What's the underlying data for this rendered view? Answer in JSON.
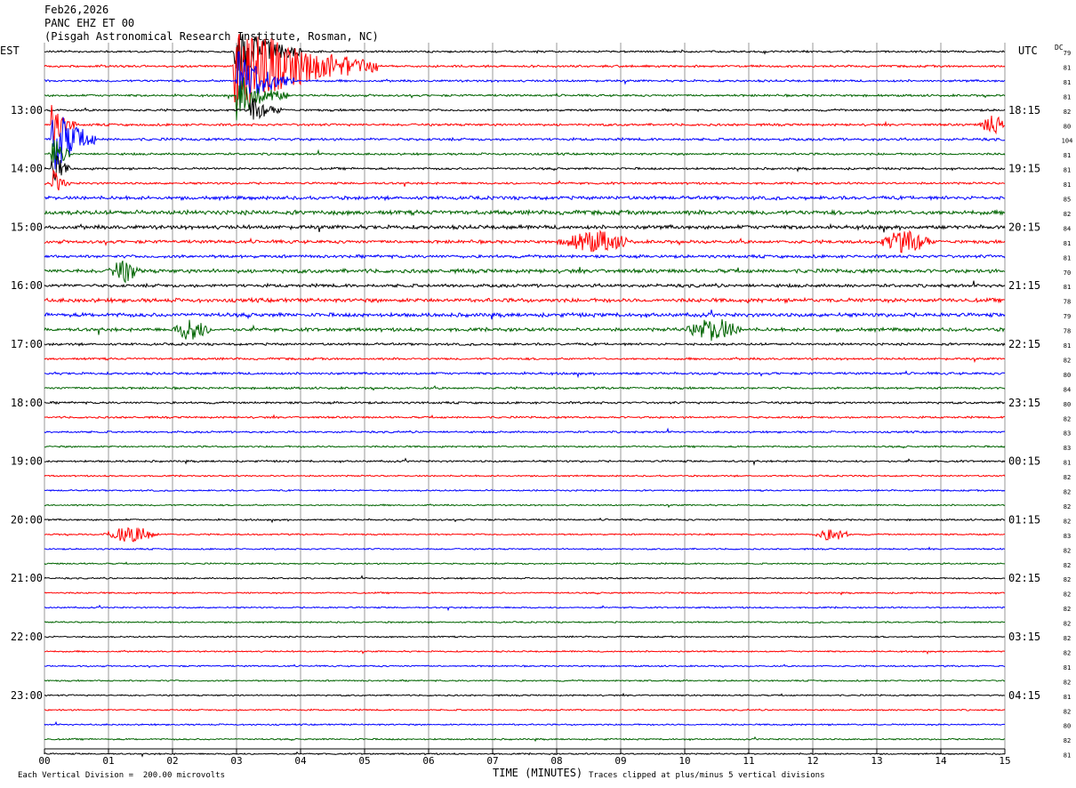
{
  "header": {
    "date": "Feb26,2026",
    "station": "PANC EHZ ET 00",
    "location": "(Pisgah Astronomical Research Institute, Rosman, NC)"
  },
  "left_timezone": "EST",
  "right_timezone": "UTC",
  "dc_label": "DC",
  "footer": {
    "scale": "Each Vertical Division =  200.00 microvolts",
    "clip_note": "Traces clipped at plus/minus 5 vertical divisions"
  },
  "colors": {
    "trace_cycle": [
      "#000000",
      "#ff0000",
      "#0000ff",
      "#006400"
    ],
    "grid": "#808080"
  },
  "chart_data": {
    "type": "line",
    "title": "PANC EHZ ET 00",
    "xlabel": "TIME (MINUTES)",
    "xlim": [
      0,
      15
    ],
    "x_ticks": [
      "00",
      "01",
      "02",
      "03",
      "04",
      "05",
      "06",
      "07",
      "08",
      "09",
      "10",
      "11",
      "12",
      "13",
      "14",
      "15"
    ],
    "left_hour_labels": [
      "13:00",
      "14:00",
      "15:00",
      "16:00",
      "17:00",
      "18:00",
      "19:00",
      "20:00",
      "21:00",
      "22:00",
      "23:00"
    ],
    "right_hour_labels": [
      "18:15",
      "19:15",
      "20:15",
      "21:15",
      "22:15",
      "23:15",
      "00:15",
      "01:15",
      "02:15",
      "03:15",
      "04:15"
    ],
    "first_hour_label_row": 4,
    "rows_per_hour": 4,
    "dc_values": [
      "79",
      "81",
      "81",
      "81",
      "82",
      "80",
      "104",
      "81",
      "81",
      "81",
      "85",
      "82",
      "84",
      "81",
      "81",
      "70",
      "81",
      "78",
      "79",
      "78",
      "81",
      "82",
      "80",
      "84",
      "80",
      "82",
      "83",
      "83",
      "81",
      "82",
      "82",
      "82",
      "82",
      "83",
      "82",
      "82",
      "82",
      "82",
      "82",
      "82",
      "82",
      "82",
      "81",
      "82",
      "81",
      "82",
      "80",
      "82",
      "81"
    ],
    "series_rows": 49,
    "row_noise": [
      0.9,
      1.0,
      1.0,
      1.0,
      1.0,
      1.1,
      1.2,
      1.0,
      1.0,
      1.0,
      1.6,
      2.0,
      1.8,
      1.5,
      1.4,
      1.8,
      1.5,
      1.8,
      1.8,
      1.6,
      1.1,
      1.0,
      1.1,
      1.0,
      1.0,
      0.9,
      0.9,
      0.8,
      0.9,
      0.7,
      0.7,
      0.7,
      0.8,
      0.7,
      0.7,
      0.7,
      0.7,
      0.7,
      0.7,
      0.7,
      0.7,
      0.7,
      0.7,
      0.7,
      0.7,
      0.7,
      0.7,
      0.7,
      0.7
    ],
    "events": [
      {
        "row": 1,
        "start_min": 2.95,
        "end_min": 5.2,
        "peak": 6,
        "clipped": true
      },
      {
        "row": 0,
        "start_min": 2.95,
        "end_min": 4.0,
        "peak": 4,
        "clipped": true
      },
      {
        "row": 2,
        "start_min": 3.0,
        "end_min": 3.9,
        "peak": 4,
        "clipped": true
      },
      {
        "row": 3,
        "start_min": 3.0,
        "end_min": 3.8,
        "peak": 3,
        "clipped": true
      },
      {
        "row": 4,
        "start_min": 3.2,
        "end_min": 3.7,
        "peak": 2,
        "clipped": true
      },
      {
        "row": 6,
        "start_min": 0.1,
        "end_min": 0.8,
        "peak": 5,
        "clipped": true
      },
      {
        "row": 5,
        "start_min": 0.1,
        "end_min": 0.5,
        "peak": 3,
        "clipped": true
      },
      {
        "row": 7,
        "start_min": 0.1,
        "end_min": 0.4,
        "peak": 3,
        "clipped": true
      },
      {
        "row": 8,
        "start_min": 0.1,
        "end_min": 0.4,
        "peak": 3,
        "clipped": true
      },
      {
        "row": 9,
        "start_min": 0.1,
        "end_min": 0.4,
        "peak": 2,
        "clipped": true
      },
      {
        "row": 5,
        "start_min": 14.6,
        "end_min": 15.0,
        "peak": 1.2,
        "clipped": false
      },
      {
        "row": 33,
        "start_min": 0.9,
        "end_min": 1.8,
        "peak": 0.9,
        "clipped": false
      },
      {
        "row": 33,
        "start_min": 12.0,
        "end_min": 12.6,
        "peak": 0.7,
        "clipped": false
      },
      {
        "row": 19,
        "start_min": 10.0,
        "end_min": 10.9,
        "peak": 1.3,
        "clipped": false
      },
      {
        "row": 19,
        "start_min": 2.0,
        "end_min": 2.6,
        "peak": 1.2,
        "clipped": false
      },
      {
        "row": 15,
        "start_min": 1.0,
        "end_min": 1.5,
        "peak": 1.2,
        "clipped": false
      },
      {
        "row": 13,
        "start_min": 8.0,
        "end_min": 9.2,
        "peak": 1.2,
        "clipped": false
      },
      {
        "row": 13,
        "start_min": 13.0,
        "end_min": 13.9,
        "peak": 1.2,
        "clipped": false
      }
    ]
  }
}
